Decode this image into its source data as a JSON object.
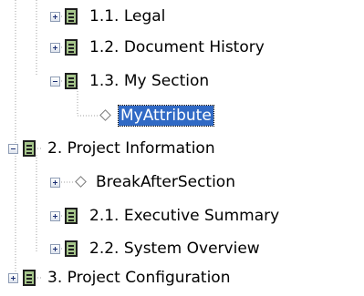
{
  "tree": {
    "nodes": [
      {
        "label": "1.1. Legal",
        "icon": "section-icon",
        "toggle": "plus"
      },
      {
        "label": "1.2. Document History",
        "icon": "section-icon",
        "toggle": "plus"
      },
      {
        "label": "1.3. My Section",
        "icon": "section-icon",
        "toggle": "minus"
      },
      {
        "label": "MyAttribute",
        "icon": "attribute-icon",
        "toggle": "none",
        "selected": true
      },
      {
        "label": "2. Project  Information",
        "icon": "section-icon",
        "toggle": "minus"
      },
      {
        "label": "BreakAfterSection",
        "icon": "attribute-icon",
        "toggle": "plus"
      },
      {
        "label": "2.1. Executive Summary",
        "icon": "section-icon",
        "toggle": "plus"
      },
      {
        "label": "2.2. System Overview",
        "icon": "section-icon",
        "toggle": "plus"
      },
      {
        "label": "3. Project Configuration",
        "icon": "section-icon",
        "toggle": "plus"
      }
    ]
  },
  "colors": {
    "selection": "#316ac5",
    "section_icon_fill": "#a7c78c",
    "tree_lines": "#a0a0a0"
  }
}
